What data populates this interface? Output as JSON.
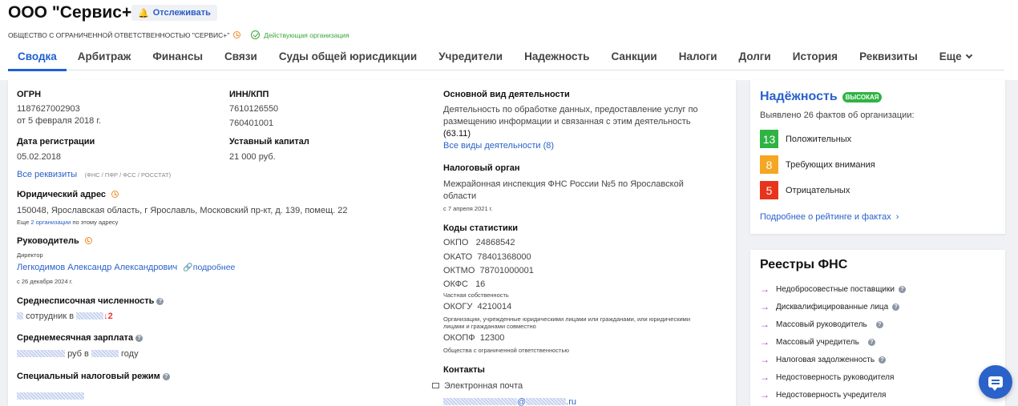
{
  "header": {
    "title": "ООО \"Сервис+\"",
    "follow_label": "Отслеживать",
    "full_name": "ОБЩЕСТВО С ОГРАНИЧЕННОЙ ОТВЕТСТВЕННОСТЬЮ \"СЕРВИС+\"",
    "status": "Действующая организация"
  },
  "tabs": [
    "Сводка",
    "Арбитраж",
    "Финансы",
    "Связи",
    "Суды общей юрисдикции",
    "Учредители",
    "Надежность",
    "Санкции",
    "Налоги",
    "Долги",
    "История",
    "Реквизиты",
    "Еще"
  ],
  "summary": {
    "ogrn_label": "ОГРН",
    "ogrn_value": "1187627002903",
    "ogrn_date": "от 5 февраля 2018 г.",
    "inn_label": "ИНН/КПП",
    "inn_value": "7610126550",
    "kpp_value": "760401001",
    "reg_date_label": "Дата регистрации",
    "reg_date_value": "05.02.2018",
    "capital_label": "Уставный капитал",
    "capital_value": "21 000 руб.",
    "all_requisites": "Все реквизиты",
    "requisites_note": "(ФНС / ПФР / ФСС / РОССТАТ)",
    "address_label": "Юридический адрес",
    "address_value": "150048, Ярославская область, г Ярославль, Московский пр-кт, д. 139, помещ. 22",
    "address_note_pre": "Еще",
    "address_note_link": "2 организации",
    "address_note_post": "по этому адресу",
    "head_label": "Руководитель",
    "head_role": "Директор",
    "head_name": "Легкодимов Александр Александрович",
    "head_more": "подробнее",
    "head_since": "с 26 декабря 2024 г.",
    "staff_label": "Среднесписочная численность",
    "staff_text": "сотрудник в",
    "staff_change": "↓2",
    "salary_label": "Среднемесячная зарплата",
    "salary_mid": "руб в",
    "salary_end": "году",
    "tax_regime_label": "Специальный налоговый режим"
  },
  "activity": {
    "label": "Основной вид деятельности",
    "text": "Деятельность по обработке данных, предоставление услуг по размещению информации и связанная с этим деятельность",
    "code": "(63.11)",
    "all_link": "Все виды деятельности (8)",
    "tax_label": "Налоговый орган",
    "tax_value": "Межрайонная инспекция ФНС России №5 по Ярославской области",
    "tax_since": "с 7 апреля 2021 г.",
    "stats_label": "Коды статистики",
    "okpo": "ОКПО   24868542",
    "okato": "ОКАТО  78401368000",
    "oktmo": "ОКТМО  78701000001",
    "okfs": "ОКФС   16",
    "okfs_note": "Частная собственность",
    "okogu": "ОКОГУ  4210014",
    "okogu_note": "Организации, учрежденные юридическими лицами или гражданами, или юридическими лицами и гражданами совместно",
    "okopf": "ОКОПФ  12300",
    "okopf_note": "Общества с ограниченной ответственностью",
    "contacts_label": "Контакты",
    "email_label": "Электронная почта",
    "email_at": "@",
    "email_tld": ".ru"
  },
  "reliability": {
    "title": "Надёжность",
    "badge": "ВЫСОКАЯ",
    "subtitle": "Выявлено 26 фактов об организации:",
    "facts": [
      {
        "count": "13",
        "label": "Положительных",
        "color": "#2fb344"
      },
      {
        "count": "8",
        "label": "Требующих внимания",
        "color": "#f5a623"
      },
      {
        "count": "5",
        "label": "Отрицательных",
        "color": "#e8341c"
      }
    ],
    "more_link": "Подробнее о рейтинге и фактах  ›"
  },
  "registries": {
    "title": "Реестры ФНС",
    "items": [
      {
        "label": "Недобросовестные поставщики",
        "help": true
      },
      {
        "label": "Дисквалифицированные лица",
        "help": true
      },
      {
        "label": "Массовый руководитель",
        "help": true
      },
      {
        "label": "Массовый учредитель",
        "help": true
      },
      {
        "label": "Налоговая задолженность",
        "help": true
      },
      {
        "label": "Недостоверность руководителя",
        "help": false
      },
      {
        "label": "Недостоверность учредителя",
        "help": false
      }
    ]
  },
  "colors": {
    "accent": "#1e5fd0",
    "link": "#2a62c9",
    "ok": "#3aa53a",
    "warn": "#f08a24",
    "arrow": "#9b3fd1"
  }
}
